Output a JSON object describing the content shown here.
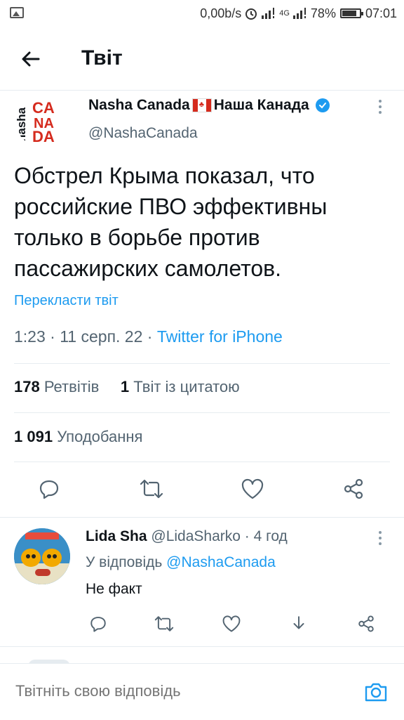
{
  "status_bar": {
    "speed": "0,00b/s",
    "network": "4G",
    "battery": "78%",
    "time": "07:01"
  },
  "header": {
    "title": "Твіт"
  },
  "tweet": {
    "author_name": "Nasha Canada",
    "author_name_suffix": "Наша Канада",
    "handle": "@NashaCanada",
    "avatar_text": [
      "nasha",
      "CA",
      "NA",
      "DA"
    ],
    "text": "Обстрел Крыма показал, что российские ПВО эффективны только в борьбе против пассажирских самолетов.",
    "translate_label": "Перекласти твіт",
    "time": "1:23",
    "date": "11 серп. 22",
    "source": "Twitter for iPhone",
    "retweets_count": "178",
    "retweets_label": "Ретвітів",
    "quotes_count": "1",
    "quotes_label": "Твіт із цитатою",
    "likes_count": "1 091",
    "likes_label": "Уподобання"
  },
  "reply": {
    "author_name": "Lida Sha",
    "handle": "@LidaSharko",
    "age": "· 4 год",
    "reply_to_prefix": "У відповідь",
    "reply_to_mention": "@NashaCanada",
    "text": "Не факт"
  },
  "compose": {
    "placeholder": "Твітніть свою відповідь"
  },
  "colors": {
    "accent": "#1d9bf0",
    "text_primary": "#0f1419",
    "text_secondary": "#536471",
    "brand_red": "#d52b1e"
  },
  "icons": {
    "back": "arrow-left-icon",
    "verified": "verified-badge-icon",
    "more": "more-vertical-icon",
    "reply": "reply-icon",
    "retweet": "retweet-icon",
    "like": "heart-icon",
    "share": "share-icon",
    "download": "download-icon",
    "camera": "camera-icon"
  }
}
